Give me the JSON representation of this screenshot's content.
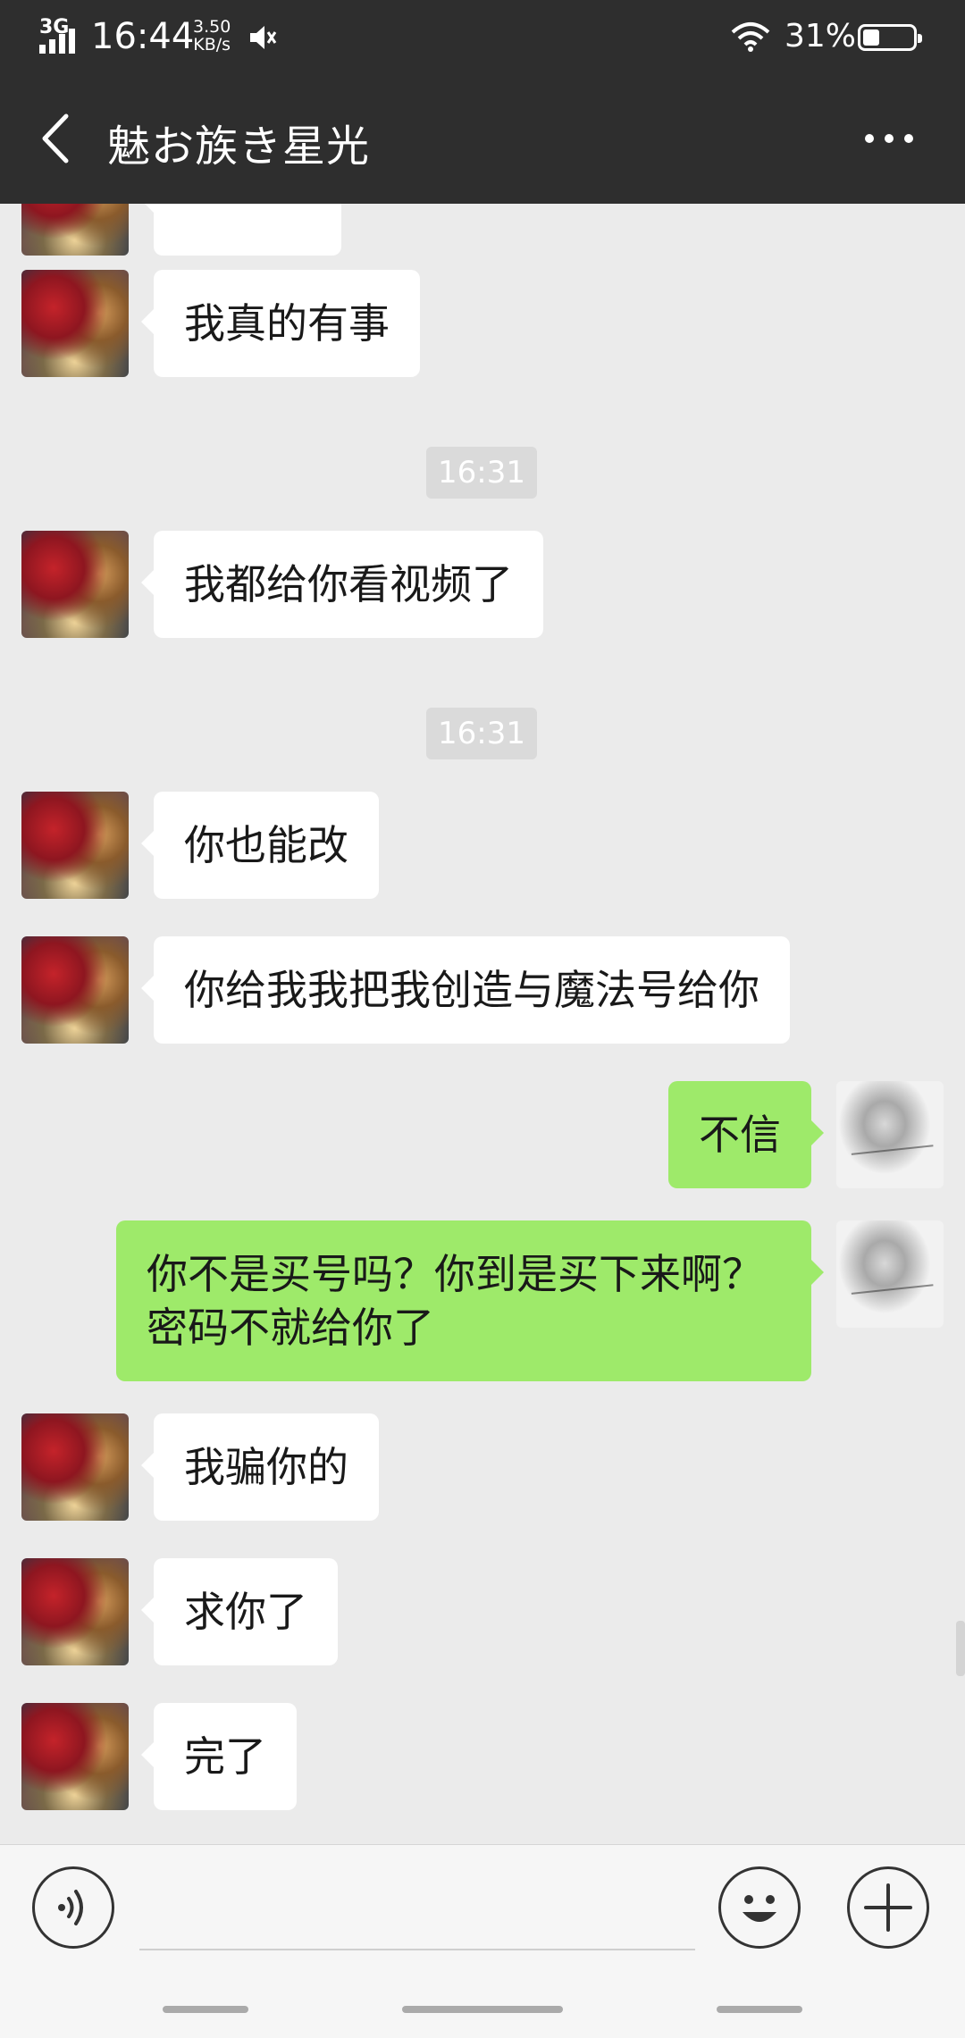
{
  "status_bar": {
    "network": "3G",
    "time": "16:44",
    "speed_value": "3.50",
    "speed_unit": "KB/s",
    "battery_percent": "31%"
  },
  "header": {
    "title": "魅お族き星光",
    "back_icon": "chevron-left-icon",
    "more_icon": "more-dots-icon"
  },
  "colors": {
    "header_bg": "#2e2e2e",
    "chat_bg": "#ebebeb",
    "incoming_bubble": "#ffffff",
    "outgoing_bubble": "#9eea6a",
    "timestamp_bg": "#dadada"
  },
  "messages": [
    {
      "from": "other",
      "text": "我真的有事"
    },
    {
      "type": "timestamp",
      "text": "16:31"
    },
    {
      "from": "other",
      "text": "我都给你看视频了"
    },
    {
      "type": "timestamp",
      "text": "16:31"
    },
    {
      "from": "other",
      "text": "你也能改"
    },
    {
      "from": "other",
      "text": "你给我我把我创造与魔法号给你"
    },
    {
      "from": "me",
      "text": "不信"
    },
    {
      "from": "me",
      "lines": [
        "你不是买号吗？你到是买下来啊？",
        "密码不就给你了"
      ]
    },
    {
      "from": "other",
      "text": "我骗你的"
    },
    {
      "from": "other",
      "text": "求你了"
    },
    {
      "from": "other",
      "text": "完了"
    }
  ],
  "input_bar": {
    "voice_icon": "voice-icon",
    "emoji_icon": "emoji-icon",
    "plus_icon": "plus-icon"
  }
}
